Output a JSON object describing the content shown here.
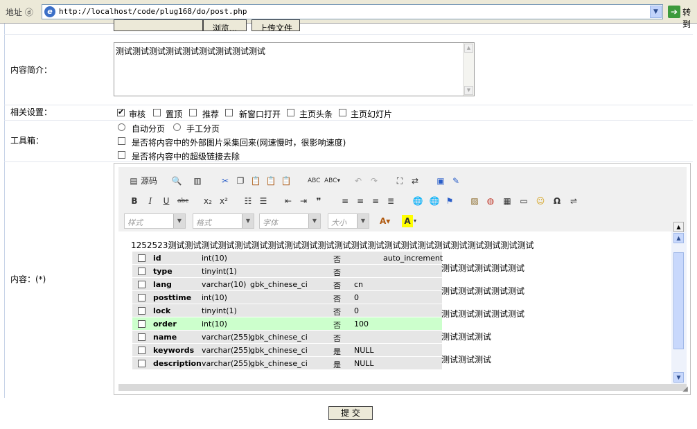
{
  "addressbar": {
    "label": "地址 ⓓ",
    "url": "http://localhost/code/plug168/do/post.php",
    "go_label": "转到"
  },
  "upload": {
    "browse_label": "浏览...",
    "upload_label": "上传文件"
  },
  "summary": {
    "label": "内容简介：",
    "text": "测试测试测试测试测试测试测试测试测试"
  },
  "settings": {
    "label": "相关设置：",
    "options": [
      {
        "label": "审核",
        "checked": true
      },
      {
        "label": "置顶",
        "checked": false
      },
      {
        "label": "推荐",
        "checked": false
      },
      {
        "label": "新窗口打开",
        "checked": false
      },
      {
        "label": "主页头条",
        "checked": false
      },
      {
        "label": "主页幻灯片",
        "checked": false
      }
    ]
  },
  "toolbox": {
    "label": "工具箱：",
    "paging": [
      "自动分页",
      "手工分页"
    ],
    "collect_images": "是否将内容中的外部图片采集回来(网速慢时，很影响速度)",
    "remove_links": "是否将内容中的超级链接去除"
  },
  "editor": {
    "label": "内容：(*)",
    "source_label": "源码",
    "combos": [
      "样式",
      "格式",
      "字体",
      "大小"
    ],
    "first_line": "1252523测试测试测试测试测试测试测试测试测试测试测试测试测试测试测试测试测试测试测试测试测试测试",
    "side_lines": [
      "测试测试测试测试测试",
      "测试测试测试测试测试",
      "测试测试测试测试测试",
      "测试测试测试",
      "测试测试测试"
    ],
    "rows": [
      {
        "name": "id",
        "type": "int(10)",
        "collation": "",
        "null": "否",
        "default": "",
        "extra": "auto_increment",
        "highlight": false
      },
      {
        "name": "type",
        "type": "tinyint(1)",
        "collation": "",
        "null": "否",
        "default": "",
        "extra": "",
        "highlight": false
      },
      {
        "name": "lang",
        "type": "varchar(10)",
        "collation": "gbk_chinese_ci",
        "null": "否",
        "default": "cn",
        "extra": "",
        "highlight": false
      },
      {
        "name": "posttime",
        "type": "int(10)",
        "collation": "",
        "null": "否",
        "default": "0",
        "extra": "",
        "highlight": false
      },
      {
        "name": "lock",
        "type": "tinyint(1)",
        "collation": "",
        "null": "否",
        "default": "0",
        "extra": "",
        "highlight": false
      },
      {
        "name": "order",
        "type": "int(10)",
        "collation": "",
        "null": "否",
        "default": "100",
        "extra": "",
        "highlight": true
      },
      {
        "name": "name",
        "type": "varchar(255)",
        "collation": "gbk_chinese_ci",
        "null": "否",
        "default": "",
        "extra": "",
        "highlight": false
      },
      {
        "name": "keywords",
        "type": "varchar(255)",
        "collation": "gbk_chinese_ci",
        "null": "是",
        "default": "NULL",
        "extra": "",
        "highlight": false
      },
      {
        "name": "description",
        "type": "varchar(255)",
        "collation": "gbk_chinese_ci",
        "null": "是",
        "default": "NULL",
        "extra": "",
        "highlight": false
      }
    ]
  },
  "submit_label": "提 交"
}
